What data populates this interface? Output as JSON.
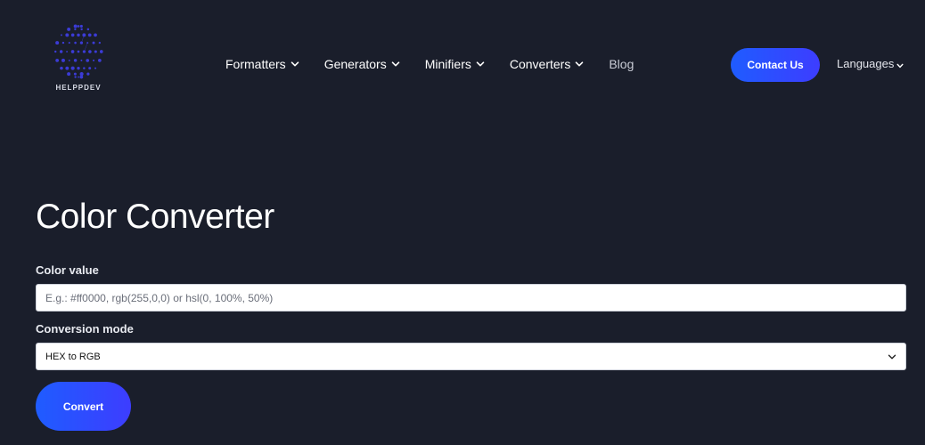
{
  "brand": {
    "name": "HELPPDEV",
    "logo_icon": "dot-globe-icon"
  },
  "nav": {
    "items": [
      {
        "label": "Formatters",
        "has_dropdown": true
      },
      {
        "label": "Generators",
        "has_dropdown": true
      },
      {
        "label": "Minifiers",
        "has_dropdown": true
      },
      {
        "label": "Converters",
        "has_dropdown": true
      },
      {
        "label": "Blog",
        "has_dropdown": false
      }
    ],
    "contact_label": "Contact Us",
    "languages_label": "Languages"
  },
  "main": {
    "title": "Color Converter",
    "color_label": "Color value",
    "color_placeholder": "E.g.: #ff0000, rgb(255,0,0) or hsl(0, 100%, 50%)",
    "color_value": "",
    "mode_label": "Conversion mode",
    "mode_value": "HEX to RGB",
    "convert_label": "Convert"
  },
  "colors": {
    "background": "#1a1e2b",
    "accent_start": "#1f5cff",
    "accent_end": "#3d3dff",
    "logo_dots": "#3b3bd6"
  }
}
